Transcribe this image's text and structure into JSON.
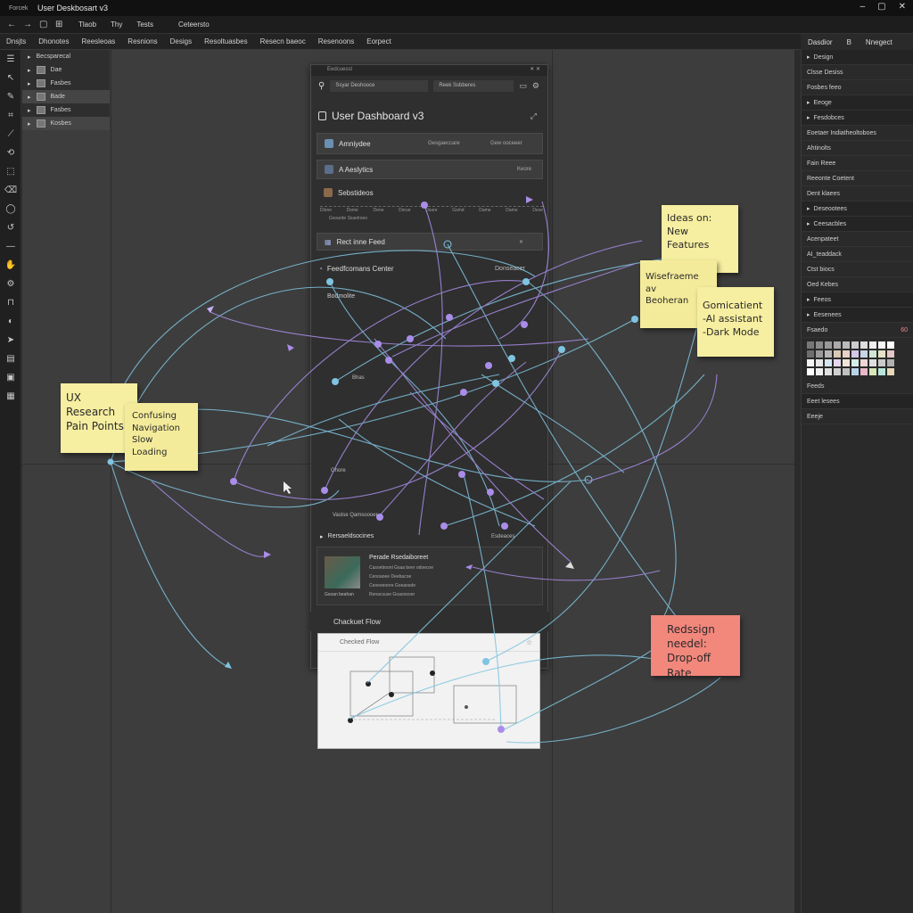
{
  "window": {
    "app_label": "Forcek",
    "title": "User Deskbosart v3",
    "controls": [
      "–",
      "▢",
      "✕"
    ]
  },
  "toolbar": {
    "menu": [
      "Tlaob",
      "Thy",
      "Tests"
    ],
    "extra": "Ceteersto"
  },
  "tabs": [
    "Dnsjts",
    "Dhonotes",
    "Reesleoas",
    "Resnions",
    "Desigs",
    "Resoltuasbes",
    "Resecn baeoc",
    "Resenoons",
    "Eorpect"
  ],
  "right_tabs": [
    "Dasdior",
    "B",
    "Nnegect"
  ],
  "layers": [
    {
      "label": "Becsparecal",
      "selected": false
    },
    {
      "label": "Dae",
      "selected": false
    },
    {
      "label": "Fasbes",
      "selected": false
    },
    {
      "label": "Bade",
      "selected": true
    },
    {
      "label": "Fasbes",
      "selected": false
    },
    {
      "label": "Kosbes",
      "selected": true
    }
  ],
  "dashboard": {
    "header": "Eedcuesst",
    "search1": "Ssyar Deshooce",
    "search2": "Reek Ssbberes",
    "title": "User Dashboard v3",
    "row1_label": "Amniydee",
    "row1_sub": "Gesgaeccare",
    "row1_sub2": "Gew ooceeer",
    "row2_label": "A Aeslytics",
    "row2_sub": "Keore",
    "row3_label": "Sebstideos",
    "axis_labels": [
      "Dlone",
      "Dsme",
      "Dene",
      "Dsrue",
      "Dsare",
      "Gsmd",
      "Dame",
      "Dame",
      "Dese"
    ],
    "axis_sub": "Gsoarde Ssaelroeo",
    "feed_label": "Rect inne Feed",
    "notif_label": "Feedfcomans Center",
    "notif_badge": "Donseacer",
    "sub_label": "Bodmolite",
    "small_label1": "Bhas",
    "small_label2": "Ghore",
    "small_label3": "Vaslse Qamsoooer",
    "recs_header": "Rersaeldsocines",
    "recs_badge": "Esdeaces",
    "rec_title": "Perade Rsedaiboreet",
    "rec_lines": [
      "Casoeboonl Gsaa beer odoecoe",
      "Cenoaoee Deebacoe",
      "Ceoeeeoore Goeaosde",
      "Renacsuse Goaoosoer"
    ],
    "rec_caption": "Gsoan beahan"
  },
  "checkout": {
    "head": "Chackuet Flow",
    "card_title": "Checked Flow"
  },
  "stickies": {
    "ux": [
      "UX Research",
      "Pain Points!"
    ],
    "confusing": [
      "Confusing",
      "Navigation",
      "Slow Loading"
    ],
    "ideas": [
      "Ideas on:",
      "New Features"
    ],
    "wireframe": [
      "Wisefraeme av",
      "Beoheran"
    ],
    "gamification": [
      "Gomicatient",
      "-Al assistant",
      "-Dark Mode"
    ],
    "redesign": [
      "Redssign",
      "needel:",
      "Drop-off Rate"
    ]
  },
  "right_panel": [
    {
      "label": "Design",
      "section": true
    },
    {
      "label": "Clsse Desiss",
      "section": false
    },
    {
      "label": "Fosbes feeo",
      "section": false
    },
    {
      "label": "Eeoge",
      "section": true
    },
    {
      "label": "Fesdobces",
      "section": true
    },
    {
      "label": "Eoetaer Indiatheoltoboes",
      "section": false
    },
    {
      "label": "Ahtinolts",
      "section": false
    },
    {
      "label": "Fain Reee",
      "section": false
    },
    {
      "label": "Reeonte Coetent",
      "section": false
    },
    {
      "label": "Dent klaees",
      "section": false
    },
    {
      "label": "Deseootees",
      "section": true
    },
    {
      "label": "Ceesacbles",
      "section": true
    },
    {
      "label": "Acenpateet",
      "section": false
    },
    {
      "label": "AI_teaddack",
      "section": false
    },
    {
      "label": "Ctst biocs",
      "section": false
    },
    {
      "label": "Oed Kebes",
      "section": false
    },
    {
      "label": "Feeos",
      "section": true
    },
    {
      "label": "Eesenees",
      "section": true
    }
  ],
  "right_panel_bottom": [
    {
      "label": "Feeds"
    },
    {
      "label": "Eeet lesees"
    },
    {
      "label": "Eeeje"
    }
  ],
  "color_grid_label": "Fsaedo",
  "color_grid_badge": "60",
  "colors": {
    "canvas": "#3d3d3d",
    "link_blue": "#7fc4e0",
    "link_purple": "#a98de8",
    "sticky_yellow": "#f6eea0",
    "sticky_red": "#f2877c"
  }
}
